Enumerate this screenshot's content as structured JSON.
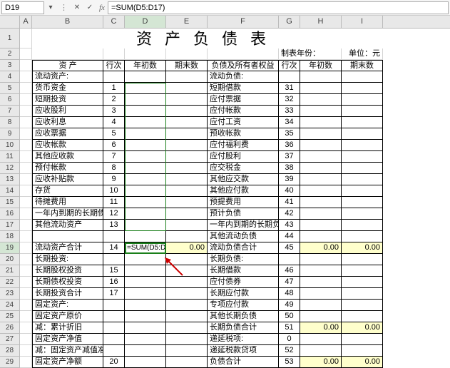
{
  "cell_ref": "D19",
  "formula": "=SUM(D5:D17)",
  "title": "资产负债表",
  "meta_left": "制表年份：",
  "meta_right": "单位：元",
  "hdr": {
    "asset": "资  产",
    "seq": "行次",
    "begin": "年初数",
    "end": "期末数",
    "liab": "负债及所有者权益"
  },
  "cols": [
    "A",
    "B",
    "C",
    "D",
    "E",
    "F",
    "G",
    "H",
    "I"
  ],
  "rows_left": [
    {
      "r": 4,
      "b": "流动资产:",
      "c": "",
      "f": "流动负债:",
      "g": ""
    },
    {
      "r": 5,
      "b": "货币资金",
      "c": "1",
      "f": "短期借款",
      "g": "31"
    },
    {
      "r": 6,
      "b": "短期投资",
      "c": "2",
      "f": "应付票据",
      "g": "32"
    },
    {
      "r": 7,
      "b": "应收股利",
      "c": "3",
      "f": "应付帐款",
      "g": "33"
    },
    {
      "r": 8,
      "b": "应收利息",
      "c": "4",
      "f": "应付工资",
      "g": "34"
    },
    {
      "r": 9,
      "b": "应收票据",
      "c": "5",
      "f": "预收帐款",
      "g": "35"
    },
    {
      "r": 10,
      "b": "应收帐款",
      "c": "6",
      "f": "应付福利费",
      "g": "36"
    },
    {
      "r": 11,
      "b": "其他应收款",
      "c": "7",
      "f": "应付股利",
      "g": "37"
    },
    {
      "r": 12,
      "b": "预付帐款",
      "c": "8",
      "f": "应交税金",
      "g": "38"
    },
    {
      "r": 13,
      "b": "应收补贴款",
      "c": "9",
      "f": "其他应交款",
      "g": "39"
    },
    {
      "r": 14,
      "b": "存货",
      "c": "10",
      "f": "其他应付款",
      "g": "40"
    },
    {
      "r": 15,
      "b": "待摊费用",
      "c": "11",
      "f": "预提费用",
      "g": "41"
    },
    {
      "r": 16,
      "b": "一年内到期的长期债权投资",
      "c": "12",
      "f": "预计负债",
      "g": "42"
    },
    {
      "r": 17,
      "b": "其他流动资产",
      "c": "13",
      "f": "一年内到期的长期负债",
      "g": "43"
    },
    {
      "r": 18,
      "b": "",
      "c": "",
      "f": "其他流动负债",
      "g": "44"
    },
    {
      "r": 19,
      "b": "流动资产合计",
      "c": "14",
      "d": "=SUM(D5:D17)",
      "e": "0.00",
      "f": "流动负债合计",
      "g": "45",
      "h": "0.00",
      "i": "0.00",
      "sum": true
    },
    {
      "r": 20,
      "b": "长期投资:",
      "c": "",
      "f": "长期负债:",
      "g": ""
    },
    {
      "r": 21,
      "b": "长期股权投资",
      "c": "15",
      "f": "长期借款",
      "g": "46"
    },
    {
      "r": 22,
      "b": "长期债权投资",
      "c": "16",
      "f": "应付债券",
      "g": "47"
    },
    {
      "r": 23,
      "b": "长期投资合计",
      "c": "17",
      "f": "长期应付款",
      "g": "48"
    },
    {
      "r": 24,
      "b": "固定资产:",
      "c": "",
      "f": "专项应付款",
      "g": "49"
    },
    {
      "r": 25,
      "b": "固定资产原价",
      "c": "",
      "f": "其他长期负债",
      "g": "50"
    },
    {
      "r": 26,
      "b": "减：累计折旧",
      "c": "",
      "f": "长期负债合计",
      "g": "51",
      "h": "0.00",
      "i": "0.00"
    },
    {
      "r": 27,
      "b": "固定资产净值",
      "c": "",
      "f": "递延税项:",
      "g": "0"
    },
    {
      "r": 28,
      "b": "减：固定资产减值准备",
      "c": "",
      "f": "递延税款贷项",
      "g": "52"
    },
    {
      "r": 29,
      "b": "固定资产净额",
      "c": "20",
      "f": "负债合计",
      "g": "53",
      "h": "0.00",
      "i": "0.00"
    }
  ],
  "chart_data": {
    "type": "table",
    "title": "资产负债表",
    "columns": [
      "资产",
      "行次",
      "年初数",
      "期末数",
      "负债及所有者权益",
      "行次",
      "年初数",
      "期末数"
    ],
    "data": [
      [
        "流动资产:",
        "",
        "",
        "",
        "流动负债:",
        "",
        "",
        ""
      ],
      [
        "货币资金",
        "1",
        "",
        "",
        "短期借款",
        "31",
        "",
        ""
      ],
      [
        "短期投资",
        "2",
        "",
        "",
        "应付票据",
        "32",
        "",
        ""
      ],
      [
        "应收股利",
        "3",
        "",
        "",
        "应付帐款",
        "33",
        "",
        ""
      ],
      [
        "应收利息",
        "4",
        "",
        "",
        "应付工资",
        "34",
        "",
        ""
      ],
      [
        "应收票据",
        "5",
        "",
        "",
        "预收帐款",
        "35",
        "",
        ""
      ],
      [
        "应收帐款",
        "6",
        "",
        "",
        "应付福利费",
        "36",
        "",
        ""
      ],
      [
        "其他应收款",
        "7",
        "",
        "",
        "应付股利",
        "37",
        "",
        ""
      ],
      [
        "预付帐款",
        "8",
        "",
        "",
        "应交税金",
        "38",
        "",
        ""
      ],
      [
        "应收补贴款",
        "9",
        "",
        "",
        "其他应交款",
        "39",
        "",
        ""
      ],
      [
        "存货",
        "10",
        "",
        "",
        "其他应付款",
        "40",
        "",
        ""
      ],
      [
        "待摊费用",
        "11",
        "",
        "",
        "预提费用",
        "41",
        "",
        ""
      ],
      [
        "一年内到期的长期债权投资",
        "12",
        "",
        "",
        "预计负债",
        "42",
        "",
        ""
      ],
      [
        "其他流动资产",
        "13",
        "",
        "",
        "一年内到期的长期负债",
        "43",
        "",
        ""
      ],
      [
        "",
        "",
        "",
        "",
        "其他流动负债",
        "44",
        "",
        ""
      ],
      [
        "流动资产合计",
        "14",
        "=SUM(D5:D17)",
        "0.00",
        "流动负债合计",
        "45",
        "0.00",
        "0.00"
      ],
      [
        "长期投资:",
        "",
        "",
        "",
        "长期负债:",
        "",
        "",
        ""
      ],
      [
        "长期股权投资",
        "15",
        "",
        "",
        "长期借款",
        "46",
        "",
        ""
      ],
      [
        "长期债权投资",
        "16",
        "",
        "",
        "应付债券",
        "47",
        "",
        ""
      ],
      [
        "长期投资合计",
        "17",
        "",
        "",
        "长期应付款",
        "48",
        "",
        ""
      ],
      [
        "固定资产:",
        "",
        "",
        "",
        "专项应付款",
        "49",
        "",
        ""
      ],
      [
        "固定资产原价",
        "",
        "",
        "",
        "其他长期负债",
        "50",
        "",
        ""
      ],
      [
        "减：累计折旧",
        "",
        "",
        "",
        "长期负债合计",
        "51",
        "0.00",
        "0.00"
      ],
      [
        "固定资产净值",
        "",
        "",
        "",
        "递延税项:",
        "0",
        "",
        ""
      ],
      [
        "减：固定资产减值准备",
        "",
        "",
        "",
        "递延税款贷项",
        "52",
        "",
        ""
      ],
      [
        "固定资产净额",
        "20",
        "",
        "",
        "负债合计",
        "53",
        "0.00",
        "0.00"
      ]
    ]
  }
}
